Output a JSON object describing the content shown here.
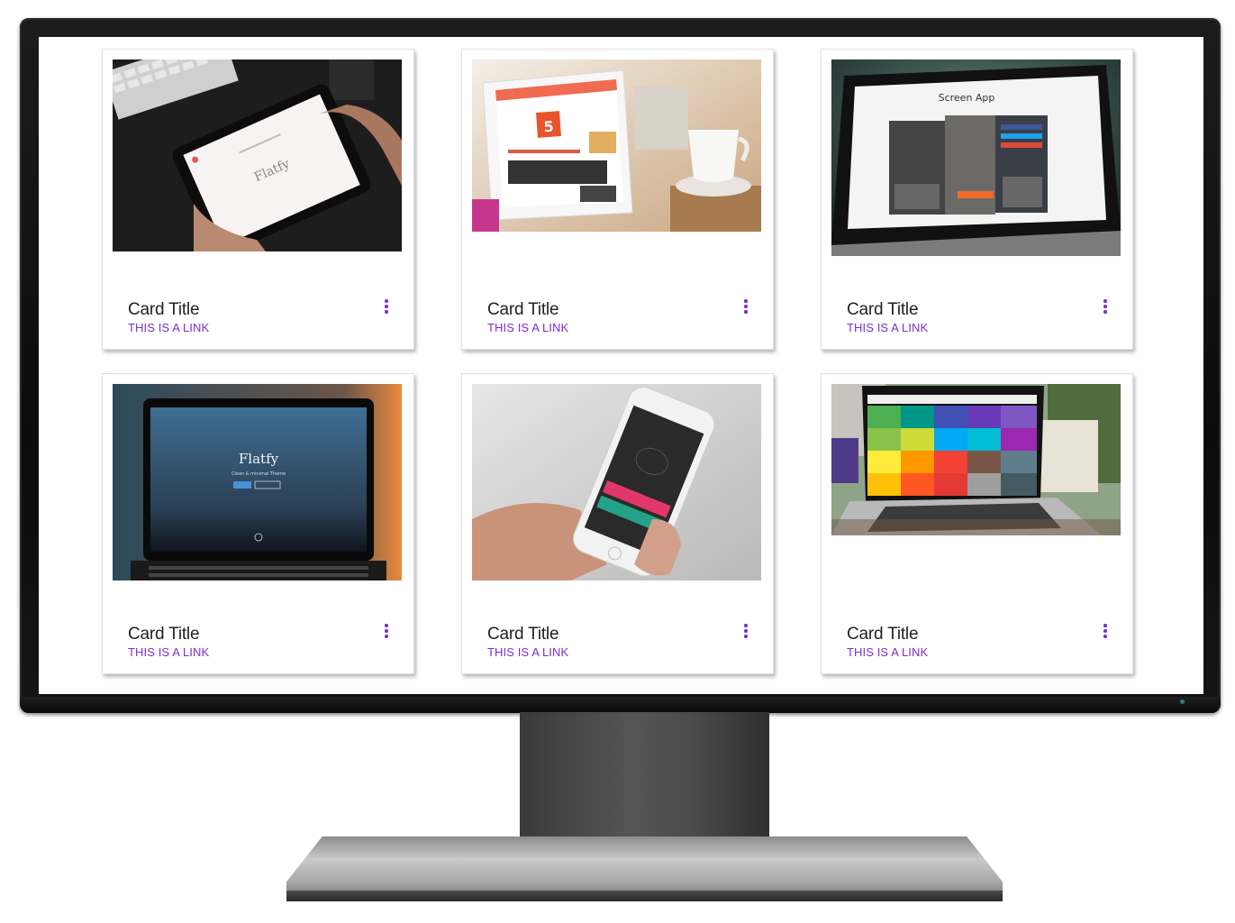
{
  "cards": [
    {
      "title": "Card Title",
      "link": "THIS IS A LINK",
      "image": "tablet-flatfy-photo",
      "more_icon": "more-vert-icon"
    },
    {
      "title": "Card Title",
      "link": "THIS IS A LINK",
      "image": "ipad-html5-coffee-photo",
      "more_icon": "more-vert-icon"
    },
    {
      "title": "Card Title",
      "link": "THIS IS A LINK",
      "image": "laptop-screen-app-photo",
      "screen_text": "Screen App",
      "more_icon": "more-vert-icon"
    },
    {
      "title": "Card Title",
      "link": "THIS IS A LINK",
      "image": "laptop-flatfy-sunset-photo",
      "screen_text": "Flatfy",
      "screen_subtext": "Clean & minimal Theme",
      "more_icon": "more-vert-icon"
    },
    {
      "title": "Card Title",
      "link": "THIS IS A LINK",
      "image": "hand-iphone-photo",
      "more_icon": "more-vert-icon"
    },
    {
      "title": "Card Title",
      "link": "THIS IS A LINK",
      "image": "laptop-color-palette-photo",
      "more_icon": "more-vert-icon"
    }
  ],
  "colors": {
    "link": "#7b2fd0",
    "title": "#222222",
    "bezel": "#111111"
  }
}
